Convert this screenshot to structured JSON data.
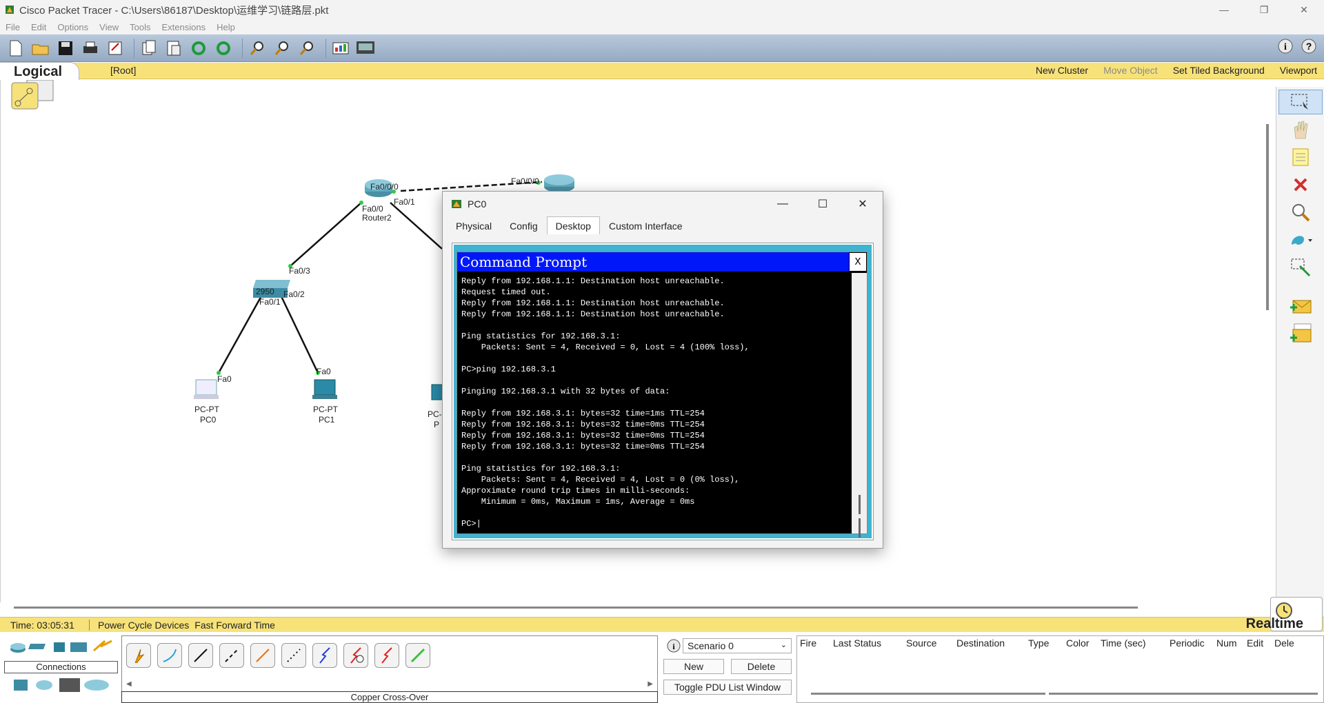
{
  "window": {
    "title": "Cisco Packet Tracer - C:\\Users\\86187\\Desktop\\运维学习\\链路层.pkt",
    "controls": {
      "minimize": "—",
      "restore": "❐",
      "close": "✕"
    }
  },
  "menu": [
    "File",
    "Edit",
    "Options",
    "View",
    "Tools",
    "Extensions",
    "Help"
  ],
  "workspace": {
    "tab": "Logical",
    "root": "[Root]",
    "actions": {
      "new_cluster": "New Cluster",
      "move_object": "Move Object",
      "tiled_bg": "Set Tiled Background",
      "viewport": "Viewport"
    }
  },
  "topology": {
    "devices": [
      {
        "id": "router2",
        "type": "Router2",
        "label": "Router2"
      },
      {
        "id": "router-b",
        "type": "router",
        "label": ""
      },
      {
        "id": "switch",
        "type": "2950",
        "label": "2950"
      },
      {
        "id": "pc0",
        "type": "PC-PT",
        "label": "PC0"
      },
      {
        "id": "pc1",
        "type": "PC-PT",
        "label": "PC1"
      },
      {
        "id": "pc2",
        "type": "PC-",
        "label": "P"
      }
    ],
    "ports": {
      "r2_fa000": "Fa0/0/0",
      "rb_fa000": "Fa0/0/0",
      "r2_fa00": "Fa0/0",
      "r2_fa01": "Fa0/1",
      "sw_fa03": "Fa0/3",
      "sw_fa02": "Fa0/2",
      "sw_fa01": "Fa0/1",
      "pc0_fa0": "Fa0",
      "pc1_fa0": "Fa0"
    },
    "pc_type": "PC-PT",
    "pc2_type": "PC-",
    "pc2_name": "P"
  },
  "pc_window": {
    "title": "PC0",
    "tabs": [
      "Physical",
      "Config",
      "Desktop",
      "Custom Interface"
    ],
    "active_tab": "Desktop",
    "cmd_title": "Command Prompt",
    "cmd_close": "X",
    "lines": [
      "Reply from 192.168.1.1: Destination host unreachable.",
      "Request timed out.",
      "Reply from 192.168.1.1: Destination host unreachable.",
      "Reply from 192.168.1.1: Destination host unreachable.",
      "",
      "Ping statistics for 192.168.3.1:",
      "    Packets: Sent = 4, Received = 0, Lost = 4 (100% loss),",
      "",
      "PC>ping 192.168.3.1",
      "",
      "Pinging 192.168.3.1 with 32 bytes of data:",
      "",
      "Reply from 192.168.3.1: bytes=32 time=1ms TTL=254",
      "Reply from 192.168.3.1: bytes=32 time=0ms TTL=254",
      "Reply from 192.168.3.1: bytes=32 time=0ms TTL=254",
      "Reply from 192.168.3.1: bytes=32 time=0ms TTL=254",
      "",
      "Ping statistics for 192.168.3.1:",
      "    Packets: Sent = 4, Received = 4, Lost = 0 (0% loss),",
      "Approximate round trip times in milli-seconds:",
      "    Minimum = 0ms, Maximum = 1ms, Average = 0ms",
      "",
      "PC>|"
    ]
  },
  "status": {
    "time": "Time: 03:05:31",
    "power_cycle": "Power Cycle Devices",
    "fast_forward": "Fast Forward Time",
    "mode": "Realtime"
  },
  "bottom": {
    "category": "Connections",
    "cable_selected": "Copper Cross-Over",
    "scenario": "Scenario 0",
    "new_btn": "New",
    "delete_btn": "Delete",
    "toggle_pdu": "Toggle PDU List Window",
    "pdu_columns": [
      "Fire",
      "Last Status",
      "Source",
      "Destination",
      "Type",
      "Color",
      "Time (sec)",
      "Periodic",
      "Num",
      "Edit",
      "Dele"
    ]
  },
  "colors": {
    "toolbar": "#a9bcd2",
    "yellow_bar": "#f7e27a",
    "cmd_title": "#0018f9",
    "desktop_frame": "#3fb3d0"
  }
}
